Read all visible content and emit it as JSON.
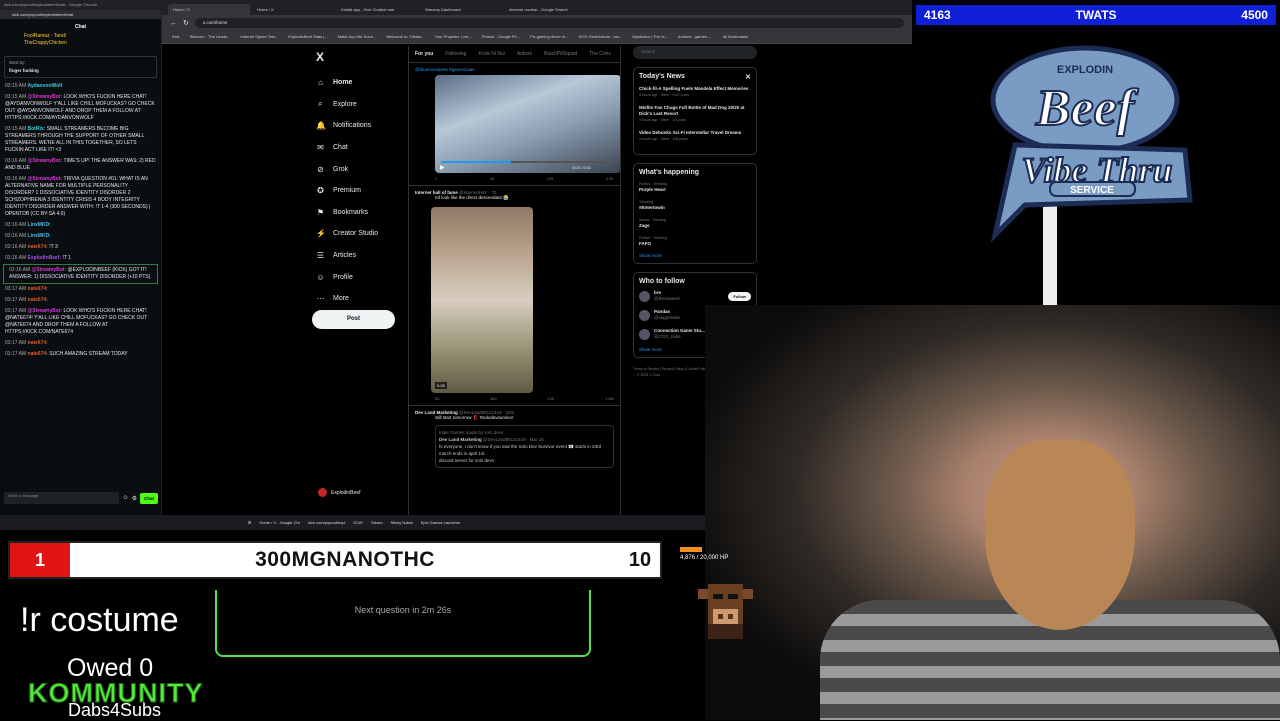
{
  "chat": {
    "tab_title": "kick.com/popout/explodinbeef/chat - Google Chrome",
    "url": "kick.com/popout/explodinbeef/chat",
    "title": "Chat",
    "gift_line1": "FoolRamaz · Tandi",
    "gift_line2": "TheCrappyChicken",
    "reply_label": "Sent by:",
    "reply_text": "finger fucking",
    "messages": [
      {
        "time": "03:15 AM",
        "user": "AydanvonWolf",
        "cls": "a",
        "text": ""
      },
      {
        "time": "03:15 AM",
        "user": "@StreamyBot:",
        "cls": "b",
        "text": "LOOK WHO'S FUCKIN HERE CHAT! @AYDANVONWOLF Y'ALL LIKE CHILL MOFUCKAS? GO CHECK OUT @AYDANVONWOLF AND DROP THEM A FOLLOW AT HTTPS://KICK.COM/AYDANVONWOLF"
      },
      {
        "time": "03:15 AM",
        "user": "BotRix:",
        "cls": "a",
        "text": "Small streamers become big streamers through the support of other small streamers. We're all in this together, so lets fuckin act like it! <3"
      },
      {
        "time": "03:16 AM",
        "user": "@StreamyBot:",
        "cls": "b",
        "text": "TIME'S UP! THE ANSWER WAS: 2) RED AND BLUE"
      },
      {
        "time": "03:16 AM",
        "user": "@StreamyBot:",
        "cls": "b",
        "text": "TRIVIA QUESTION #01: WHAT IS AN ALTERNATIVE NAME FOR MULTIPLE PERSONALITY DISORDER? 1 DISSOCIATIVE IDENTITY DISORDER 2 SCHIZOPHRENIA 3 IDENTITY CRISIS 4 BODY INTEGRITY IDENTITY DISORDER ANSWER WITH: !T 1-4 (300 SECONDS) | OPENTDB (CC BY-SA 4.0)"
      },
      {
        "time": "03:16 AM",
        "user": "LinxMKD:",
        "cls": "d",
        "text": ""
      },
      {
        "time": "03:16 AM",
        "user": "LinxMKD:",
        "cls": "d",
        "text": ""
      },
      {
        "time": "03:16 AM",
        "user": "nate674:",
        "cls": "c",
        "text": "!t 3"
      },
      {
        "time": "03:16 AM",
        "user": "ExplodinBeef:",
        "cls": "e",
        "text": "!t 1"
      },
      {
        "time": "03:16 AM",
        "user": "@StreamyBot:",
        "cls": "b",
        "text": "@EXPLODINBEEF (KICK) GOT IT! ANSWER: 1) DISSOCIATIVE IDENTITY DISORDER (+10 PTS)"
      },
      {
        "time": "03:17 AM",
        "user": "nate674:",
        "cls": "c",
        "text": ""
      },
      {
        "time": "03:17 AM",
        "user": "nate674:",
        "cls": "c",
        "text": ""
      },
      {
        "time": "03:17 AM",
        "user": "@StreamyBot:",
        "cls": "b",
        "text": "LOOK WHO'S FUCKIN HERE CHAT! @NATE674! Y'ALL LIKE CHILL MOFUCKAS? GO CHECK OUT @NATE674 AND DROP THEM A FOLLOW AT HTTPS://KICK.COM/NATE674"
      },
      {
        "time": "03:17 AM",
        "user": "nate674:",
        "cls": "c",
        "text": ""
      },
      {
        "time": "03:17 AM",
        "user": "nate674:",
        "cls": "c",
        "text": "such amazing stream today"
      }
    ],
    "input_placeholder": "Send a message",
    "send_label": "Chat"
  },
  "browser": {
    "tabs": [
      "Home / X",
      "Home / X",
      "Kiddat.app - Kick Chatbot and",
      "Streamy Dashboard",
      "dimeme nuclear - Google Search"
    ],
    "url": "x.com/home",
    "bookmarks": [
      "Kick",
      "Starcum - The Leade...",
      "Internet Speed Test...",
      "ExplodinBeef Stats |...",
      "Make Any Mic Soun...",
      "Welcome to: Olidao...",
      "Your Projector | cre...",
      "Photos - Google Ph...",
      "Fix gaming driver m...",
      "KICK Restrictions - mo...",
      "Mysticism | The Ia...",
      "Andrew - games -...",
      "All Bookmarks"
    ]
  },
  "x": {
    "logo": "X",
    "nav": [
      {
        "icon": "⌂",
        "label": "Home",
        "name": "home"
      },
      {
        "icon": "⌕",
        "label": "Explore",
        "name": "explore"
      },
      {
        "icon": "🔔",
        "label": "Notifications",
        "name": "notifications"
      },
      {
        "icon": "✉",
        "label": "Chat",
        "name": "chat"
      },
      {
        "icon": "⊘",
        "label": "Grok",
        "name": "grok"
      },
      {
        "icon": "✪",
        "label": "Premium",
        "name": "premium"
      },
      {
        "icon": "⚑",
        "label": "Bookmarks",
        "name": "bookmarks"
      },
      {
        "icon": "⚡",
        "label": "Creator Studio",
        "name": "creator-studio"
      },
      {
        "icon": "☰",
        "label": "Articles",
        "name": "articles"
      },
      {
        "icon": "☺",
        "label": "Profile",
        "name": "profile"
      },
      {
        "icon": "⋯",
        "label": "More",
        "name": "more"
      }
    ],
    "post_label": "Post",
    "account": "ExplodinBeef",
    "account_handle": "@ExplodinBeef",
    "feed_tabs": [
      "For you",
      "Following",
      "Kook Ni Nui",
      "Autism",
      "ButchPitSquad",
      "The Conv"
    ],
    "tweets": [
      {
        "author": "",
        "handle": "",
        "text": "@bluemoonpets #gamescaae",
        "time": "0:03 / 0:01",
        "stats": [
          "1",
          "18",
          "129",
          "4.9K"
        ]
      },
      {
        "author": "Internet hall of fame",
        "handle": "@InternetH4F · 7h",
        "text": "mf look like the direct descendant 😭",
        "dur": "0:05",
        "stats": [
          "56",
          "464",
          "10K",
          "1.8M"
        ]
      },
      {
        "author": "Dev Land Marketing",
        "handle": "@DevLand85121419 · 42m",
        "text": "still start tomorrow ‼️ #solodevsurvivor",
        "quote_label": "Indie Games made by solo devs",
        "quote_author": "Dev Land Marketing",
        "quote_handle": "@DevLand85121419 · Mar 16",
        "quote_text": "hi everyone, I don't know if you saw the Solo Dev Survivor event 👀 starts in 23rd march ends in april 1st.",
        "quote_text2": "discord server for solo devs :"
      }
    ],
    "search_placeholder": "Search",
    "news_title": "Today's News",
    "news": [
      {
        "title": "Chick-fil-A Spelling Fuels Mandela Effect Memories",
        "meta": "4 hours ago · Other · 3.4K posts"
      },
      {
        "title": "Misfits Fan Chugs Full Bottle of Mad Dog 20/20 at Dick's Last Resort",
        "meta": "4 hours ago · Other · 10 posts"
      },
      {
        "title": "Video Debunks Sci-Fi Interstellar Travel Dreams",
        "meta": "4 hours ago · Other · 128 posts"
      }
    ],
    "happening_title": "What's happening",
    "trends": [
      {
        "meta": "Politics · Trending",
        "name": "Purple Heart"
      },
      {
        "meta": "Trending",
        "name": "#Entertowin"
      },
      {
        "meta": "Sports · Trending",
        "name": "Zags"
      },
      {
        "meta": "Politics · Trending",
        "name": "FAFO"
      }
    ],
    "show_more": "Show more",
    "wtf_title": "Who to follow",
    "who_to_follow": [
      {
        "name": "bre",
        "handle": "@BreSweetz"
      },
      {
        "name": "Pandas",
        "handle": "@iiagpandas"
      },
      {
        "name": "Connection Game Stu...",
        "handle": "@CGS_Indie"
      }
    ],
    "follow_label": "Follow",
    "footer": "Terms of Service | Privacy Policy | Cookie Policy | Accessibility | Ads info | More ... © 2025 X Corp."
  },
  "taskbar": {
    "items": [
      "Home / X - Google Chr",
      "kick.com/popout/expl",
      "ICUE",
      "Steam",
      "Sticky Notes",
      "Epic Games Launcher"
    ],
    "time": "3:18 AM 3/22/2025"
  },
  "overlay": {
    "score_left": "4163",
    "score_title": "TWATS",
    "score_right": "4500",
    "logo_top": "EXPLODIN",
    "logo_main": "Beef",
    "logo_sub": "Vibe Thru",
    "logo_service": "SERVICE",
    "trivia_rank": "1",
    "trivia_name": "300MGNANOTHC",
    "trivia_score": "10",
    "command": "!r costume",
    "next_question": "Next question in 2m 26s",
    "boss_hp": "4,876 / 20,000 HP",
    "owed": "Owed 0",
    "community": "KOMMUNITY",
    "dabs": "Dabs4Subs"
  },
  "colors": {
    "accent": "#53fc18",
    "x_blue": "#1d9bf0",
    "overlay_blue": "#1020d8",
    "trivia_red": "#e01414"
  }
}
